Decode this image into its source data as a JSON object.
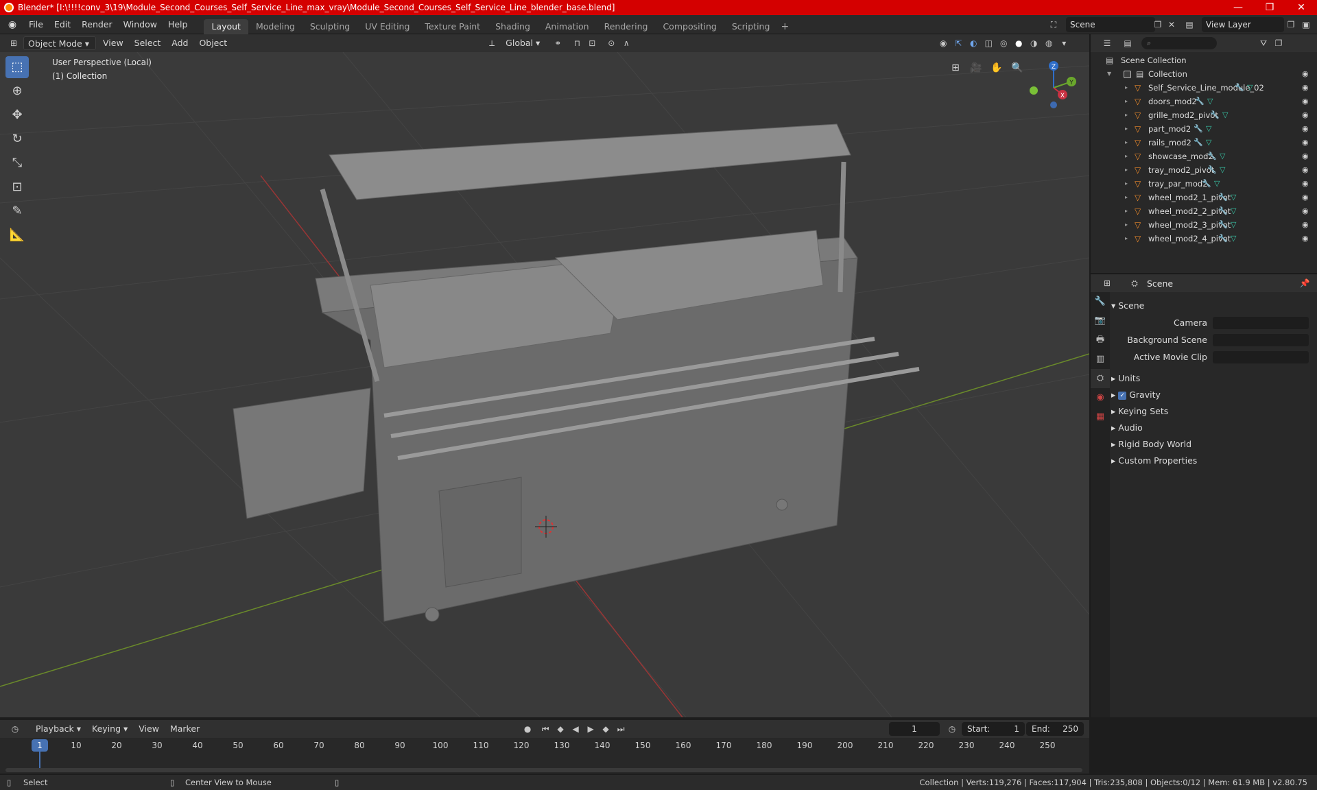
{
  "window": {
    "title": "Blender* [I:\\!!!!conv_3\\19\\Module_Second_Courses_Self_Service_Line_max_vray\\Module_Second_Courses_Self_Service_Line_blender_base.blend]",
    "minimize": "—",
    "maximize": "❐",
    "close": "✕"
  },
  "menu": [
    "File",
    "Edit",
    "Render",
    "Window",
    "Help"
  ],
  "workspaces": [
    "Layout",
    "Modeling",
    "Sculpting",
    "UV Editing",
    "Texture Paint",
    "Shading",
    "Animation",
    "Rendering",
    "Compositing",
    "Scripting"
  ],
  "active_workspace": "Layout",
  "scene_name": "Scene",
  "view_layer": "View Layer",
  "viewport_header": {
    "mode": "Object Mode",
    "menus": [
      "View",
      "Select",
      "Add",
      "Object"
    ],
    "orientation": "Global"
  },
  "viewport": {
    "perspective_label": "User Perspective (Local)",
    "collection_label": "(1) Collection",
    "gizmo_axes": {
      "x": "X",
      "y": "Y",
      "z": "Z"
    }
  },
  "outliner": {
    "root": "Scene Collection",
    "collection": "Collection",
    "objects": [
      "Self_Service_Line_module_02",
      "doors_mod2",
      "grille_mod2_pivot",
      "part_mod2",
      "rails_mod2",
      "showcase_mod2",
      "tray_mod2_pivot",
      "tray_par_mod2",
      "wheel_mod2_1_pivot",
      "wheel_mod2_2_pivot",
      "wheel_mod2_3_pivot",
      "wheel_mod2_4_pivot"
    ]
  },
  "properties": {
    "header": "Scene",
    "section": "Scene",
    "fields": [
      {
        "label": "Camera"
      },
      {
        "label": "Background Scene"
      },
      {
        "label": "Active Movie Clip"
      }
    ],
    "panels": [
      "Units",
      "Gravity",
      "Keying Sets",
      "Audio",
      "Rigid Body World",
      "Custom Properties"
    ]
  },
  "timeline": {
    "menus": [
      "Playback",
      "Keying",
      "View",
      "Marker"
    ],
    "current_frame": "1",
    "start_label": "Start:",
    "start": "1",
    "end_label": "End:",
    "end": "250",
    "ruler": [
      "10",
      "20",
      "30",
      "40",
      "50",
      "60",
      "70",
      "80",
      "90",
      "100",
      "110",
      "120",
      "130",
      "140",
      "150",
      "160",
      "170",
      "180",
      "190",
      "200",
      "210",
      "220",
      "230",
      "240",
      "250"
    ]
  },
  "statusbar": {
    "left": "Select",
    "middle": "Center View to Mouse",
    "right": "Collection | Verts:119,276 | Faces:117,904 | Tris:235,808 | Objects:0/12 | Mem: 61.9 MB | v2.80.75"
  },
  "colors": {
    "accent": "#4772b3",
    "titlebar": "#d40000",
    "object_icon": "#ee8a2b",
    "modifier_icon": "#6fa5ec",
    "mesh_icon": "#39c6a7"
  }
}
